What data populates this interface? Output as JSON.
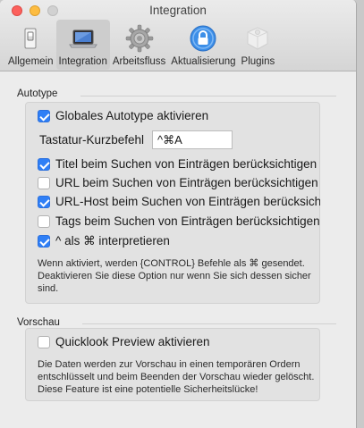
{
  "window": {
    "title": "Integration"
  },
  "toolbar": {
    "items": [
      {
        "label": "Allgemein",
        "icon": "switch-icon",
        "selected": false
      },
      {
        "label": "Integration",
        "icon": "laptop-icon",
        "selected": true
      },
      {
        "label": "Arbeitsfluss",
        "icon": "gear-icon",
        "selected": false
      },
      {
        "label": "Aktualisierung",
        "icon": "lock-icon",
        "selected": false
      },
      {
        "label": "Plugins",
        "icon": "puzzle-icon",
        "selected": false
      }
    ]
  },
  "autotype": {
    "section_title": "Autotype",
    "enable": {
      "label": "Globales Autotype aktivieren",
      "checked": true
    },
    "shortcut": {
      "label": "Tastatur-Kurzbefehl",
      "value": "^⌘A"
    },
    "options": [
      {
        "label": "Titel beim Suchen von Einträgen berücksichtigen",
        "checked": true
      },
      {
        "label": "URL beim Suchen von Einträgen berücksichtigen",
        "checked": false
      },
      {
        "label": "URL-Host beim Suchen von Einträgen berücksichtigen",
        "checked": true
      },
      {
        "label": "Tags beim Suchen von Einträgen berücksichtigen",
        "checked": false
      },
      {
        "label": "^ als ⌘ interpretieren",
        "checked": true
      }
    ],
    "note": "Wenn aktiviert, werden {CONTROL} Befehle als ⌘ gesendet. Deaktivieren Sie diese Option nur wenn Sie sich dessen sicher sind."
  },
  "preview": {
    "section_title": "Vorschau",
    "quicklook": {
      "label": "Quicklook Preview aktivieren",
      "checked": false
    },
    "note": "Die Daten werden zur Vorschau in einen temporären Ordern entschlüsselt und beim Beenden der Vorschau wieder gelöscht. Diese Feature ist eine potentielle Sicherheitslücke!"
  },
  "colors": {
    "accent": "#2f7ff6",
    "window_bg": "#ececec",
    "group_bg": "#e2e2e2"
  }
}
